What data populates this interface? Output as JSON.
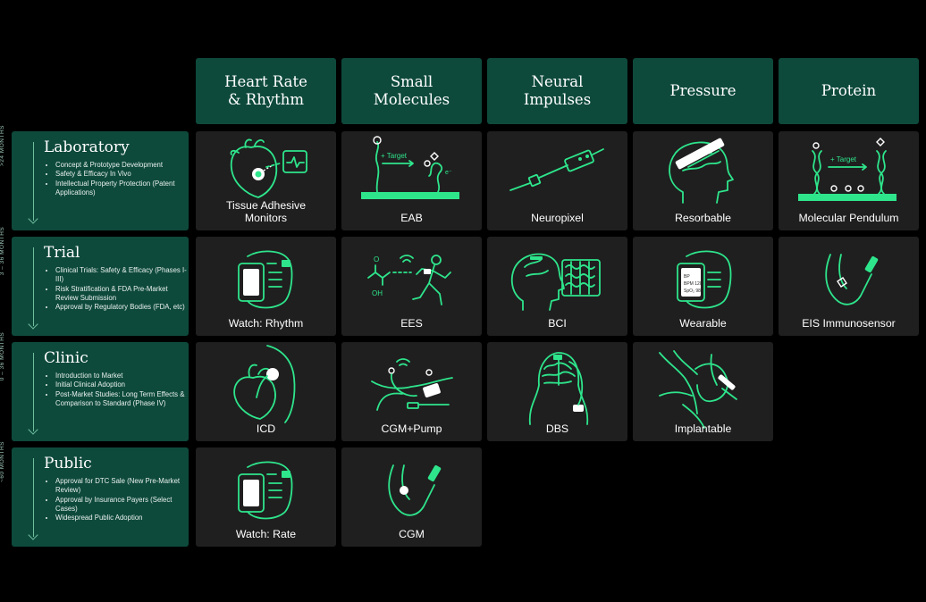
{
  "columns": [
    "Heart Rate\n& Rhythm",
    "Small\nMolecules",
    "Neural\nImpulses",
    "Pressure",
    "Protein"
  ],
  "rows": [
    {
      "title": "Laboratory",
      "duration": ">24 MONTHS",
      "bullets": [
        "Concept & Prototype Development",
        "Safety & Efficacy In Vivo",
        "Intellectual Property Protection (Patent Applications)"
      ],
      "cells": [
        "Tissue Adhesive\nMonitors",
        "EAB",
        "Neuropixel",
        "Resorbable",
        "Molecular Pendulum"
      ]
    },
    {
      "title": "Trial",
      "duration": "3 – 36 MONTHS",
      "bullets": [
        "Clinical Trials: Safety & Efficacy (Phases I-III)",
        "Risk Stratification & FDA Pre-Market Review Submission",
        "Approval by Regulatory Bodies (FDA, etc)"
      ],
      "cells": [
        "Watch: Rhythm",
        "EES",
        "BCI",
        "Wearable",
        "EIS Immunosensor"
      ]
    },
    {
      "title": "Clinic",
      "duration": "0 – 36 MONTHS",
      "bullets": [
        "Introduction to Market",
        "Initial Clinical Adoption",
        "Post-Market Studies: Long Term Effects & Comparison to Standard (Phase IV)"
      ],
      "cells": [
        "ICD",
        "CGM+Pump",
        "DBS",
        "Implantable"
      ]
    },
    {
      "title": "Public",
      "duration": "~60 MONTHS",
      "bullets": [
        "Approval for DTC Sale (New Pre-Market Review)",
        "Approval by Insurance Payers (Select Cases)",
        "Widespread Public Adoption"
      ],
      "cells": [
        "Watch: Rate",
        "CGM"
      ]
    }
  ],
  "illustration_text": {
    "target": "+ Target",
    "target_protein": "+ Target",
    "oh": "OH",
    "o": "O",
    "e": "e⁻",
    "watch_screen": [
      "BP",
      "BPM 120",
      "SpO₂ 98"
    ]
  },
  "colors": {
    "background": "#000000",
    "header_fill": "#0e4a3c",
    "cell_fill": "#1f1f1f",
    "accent_green": "#2ee58c"
  }
}
